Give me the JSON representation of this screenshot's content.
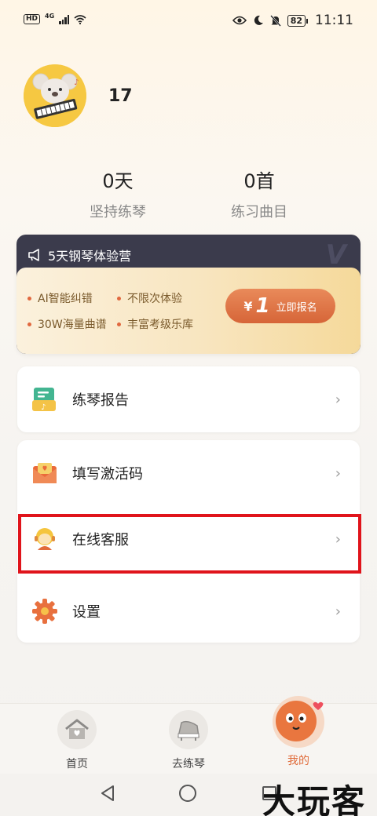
{
  "status_bar": {
    "hd_badge": "HD",
    "network": "4G",
    "battery": "82",
    "time": "11:11"
  },
  "profile": {
    "username": "17"
  },
  "stats": [
    {
      "value": "0天",
      "label": "坚持练琴"
    },
    {
      "value": "0首",
      "label": "练习曲目"
    }
  ],
  "promo": {
    "title": "5天钢琴体验营",
    "features": [
      "AI智能纠错",
      "不限次体验",
      "30W海量曲谱",
      "丰富考级乐库"
    ],
    "button": {
      "currency": "¥",
      "price": "1",
      "label": "立即报名"
    }
  },
  "menu": [
    {
      "label": "练琴报告",
      "icon": "report-icon"
    },
    {
      "label": "填写激活码",
      "icon": "envelope-icon"
    },
    {
      "label": "在线客服",
      "icon": "support-agent-icon"
    },
    {
      "label": "设置",
      "icon": "gear-icon"
    }
  ],
  "chevron": "›",
  "tabs": [
    {
      "label": "首页",
      "icon": "home-icon"
    },
    {
      "label": "去练琴",
      "icon": "piano-icon"
    },
    {
      "label": "我的",
      "icon": "profile-mascot-icon",
      "active": true
    }
  ],
  "watermark": "大玩客",
  "colors": {
    "accent": "#e06b3a",
    "promo_dark": "#3b3b4c",
    "highlight": "#e0141b"
  }
}
